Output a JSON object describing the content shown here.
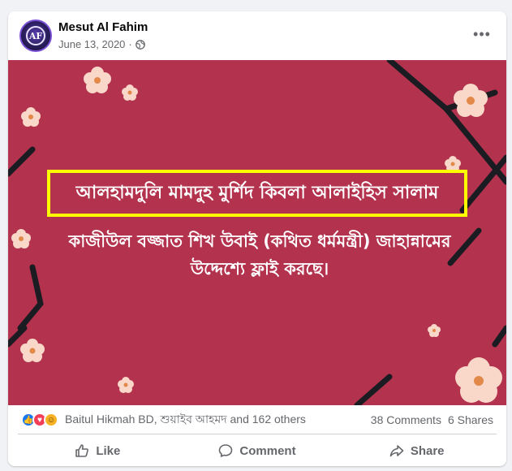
{
  "post": {
    "author": "Mesut Al Fahim",
    "date": "June 13, 2020",
    "dot": "·",
    "avatar_letters": "AF",
    "more_label": "•••",
    "image": {
      "headline": "আলহামদুলি মামদুহ মুর্শিদ কিবলা আলাইহিস সালাম",
      "subtext_line1": "কাজীউল বজ্জাত শিখ উবাই (কথিত ধর্মমন্ত্রী) জাহান্নামের",
      "subtext_line2": "উদ্দেশ্যে ফ্লাই করছে।",
      "background_color": "#b3334e",
      "highlight_color": "#ffff00"
    },
    "reactions": {
      "icons": [
        "like-icon",
        "love-icon",
        "haha-icon"
      ],
      "summary": "Baitul Hikmah BD, শুয়াইব আহমদ and 162 others",
      "comments": "38 Comments",
      "shares": "6 Shares"
    },
    "actions": {
      "like": "Like",
      "comment": "Comment",
      "share": "Share"
    }
  }
}
